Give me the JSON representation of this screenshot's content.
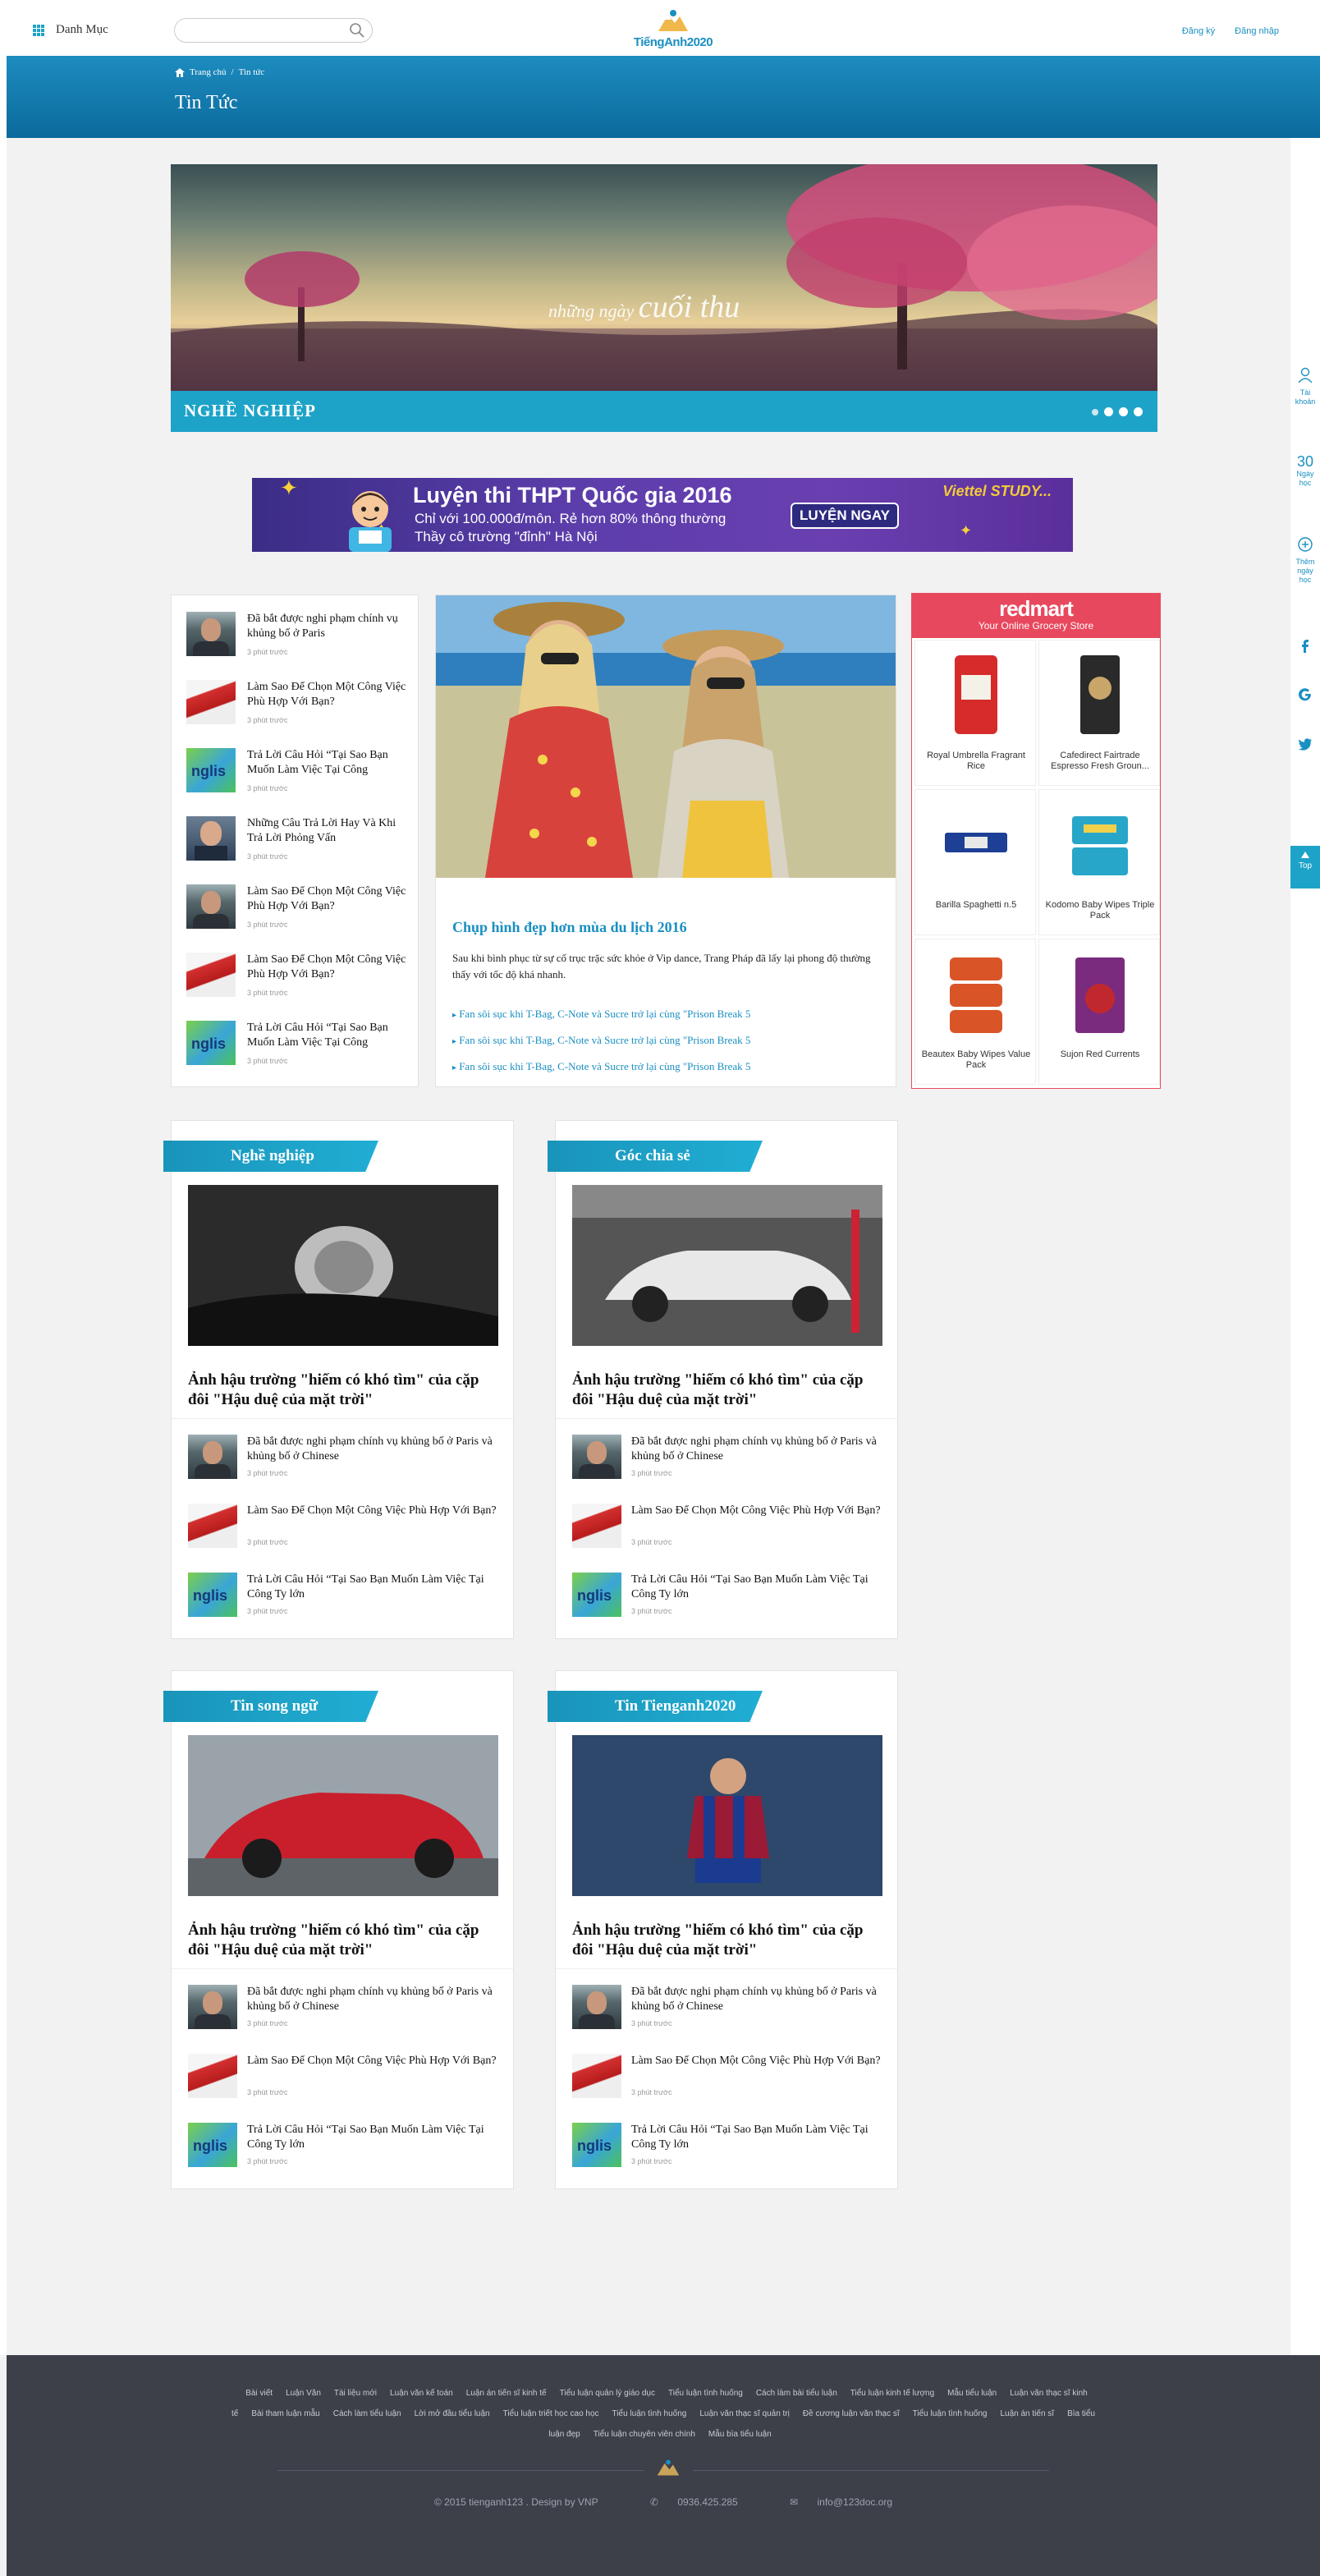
{
  "header": {
    "menu_label": "Danh Mục",
    "search_placeholder": "",
    "logo_text": "TiếngAnh2020",
    "register": "Đăng ký",
    "login": "Đăng nhập"
  },
  "breadcrumb": {
    "home": "Trang chủ",
    "separator": "/",
    "current": "Tin tức"
  },
  "page_title": "Tin Tức",
  "right_rail": {
    "account": "Tài khoản",
    "days_number": "30",
    "days_label": "Ngày học",
    "add_days": "Thêm ngày học",
    "top": "Top"
  },
  "slider": {
    "label": "NGHỀ NGHIỆP",
    "slide_text_small": "những ngày",
    "slide_text_big": "cuối thu",
    "dot_count": 4
  },
  "ad": {
    "title": "Luyện thi THPT Quốc gia 2016",
    "line1": "Chỉ với 100.000đ/môn. Rẻ hơn 80% thông thường",
    "line2": "Thầy cô trường \"đỉnh\" Hà Nội",
    "cta": "LUYỆN NGAY",
    "brand": "Viettel STUDY..."
  },
  "news_list": [
    {
      "title": "Đã bắt được nghi phạm chính vụ khủng bố ở Paris",
      "time": "3 phút trước",
      "thumb": "person"
    },
    {
      "title": "Làm Sao Để Chọn Một Công Việc Phù Hợp Với Bạn?",
      "time": "3 phút trước",
      "thumb": "card"
    },
    {
      "title": "Trả Lời Câu Hỏi “Tại Sao Bạn Muốn Làm Việc Tại Công",
      "time": "3 phút trước",
      "thumb": "eng"
    },
    {
      "title": "Những Câu Trả Lời Hay Và Khi Trả Lời Phỏng Vấn",
      "time": "3 phút trước",
      "thumb": "man2"
    },
    {
      "title": "Làm Sao Để Chọn Một Công Việc Phù Hợp Với Bạn?",
      "time": "3 phút trước",
      "thumb": "person"
    },
    {
      "title": "Làm Sao Để Chọn Một Công Việc Phù Hợp Với Bạn?",
      "time": "3 phút trước",
      "thumb": "card"
    },
    {
      "title": "Trả Lời Câu Hỏi “Tại Sao Bạn Muốn Làm Việc Tại Công",
      "time": "3 phút trước",
      "thumb": "eng"
    }
  ],
  "feature": {
    "title": "Chụp hình đẹp hơn mùa du lịch 2016",
    "desc": "Sau khi bình phục từ sự cố trục trặc sức khỏe ở Vip dance, Trang Pháp đã lấy lại phong độ thường thấy với tốc độ khá nhanh.",
    "links": [
      "Fan sôi sục khi T-Bag, C-Note và Sucre trở lại cùng \"Prison Break 5",
      "Fan sôi sục khi T-Bag, C-Note và Sucre trở lại cùng \"Prison Break 5",
      "Fan sôi sục khi T-Bag, C-Note và Sucre trở lại cùng \"Prison Break 5"
    ]
  },
  "redmart": {
    "brand": "redmart",
    "sub": "Your Online Grocery Store",
    "products": [
      "Royal Umbrella Fragrant Rice",
      "Cafedirect Fairtrade Espresso Fresh Groun...",
      "Barilla Spaghetti n.5",
      "Kodomo Baby Wipes Triple Pack",
      "Beautex Baby Wipes Value Pack",
      "Sujon Red Currents"
    ]
  },
  "categories": [
    {
      "name": "Nghề nghiệp",
      "headline": "Ảnh hậu trường \"hiếm có khó tìm\" của cặp đôi \"Hậu duệ của mặt trời\"",
      "image": "man-lying"
    },
    {
      "name": "Góc chia sẻ",
      "headline": "Ảnh hậu trường \"hiếm có khó tìm\" của cặp đôi \"Hậu duệ của mặt trời\"",
      "image": "white-car"
    },
    {
      "name": "Tin song ngữ",
      "headline": "Ảnh hậu trường \"hiếm có khó tìm\" của cặp đôi \"Hậu duệ của mặt trời\"",
      "image": "red-car"
    },
    {
      "name": "Tin Tienganh2020",
      "headline": "Ảnh hậu trường \"hiếm có khó tìm\" của cặp đôi \"Hậu duệ của mặt trời\"",
      "image": "footballer"
    }
  ],
  "cat_items": [
    {
      "title": "Đã bắt được nghi phạm chính vụ khủng bố ở Paris và khủng bố ở Chinese",
      "time": "3 phút trước",
      "thumb": "person"
    },
    {
      "title": "Làm Sao Để Chọn Một Công Việc Phù Hợp Với Bạn?",
      "time": "3 phút trước",
      "thumb": "card"
    },
    {
      "title": "Trả Lời Câu Hỏi “Tại Sao Bạn Muốn Làm Việc Tại Công Ty lớn",
      "time": "3 phút trước",
      "thumb": "eng"
    }
  ],
  "footer": {
    "links": [
      "Bài viết",
      "Luận Văn",
      "Tài liệu mới",
      "Luận văn kế toán",
      "Luận án tiến sĩ kinh tế",
      "Tiểu luận quản lý giáo dục",
      "Tiểu luận tình huống",
      "Cách làm bài tiểu luận",
      "Tiểu luận kinh tế lượng",
      "Mẫu tiểu luận",
      "Luận văn thạc sĩ kinh tế",
      "Bài tham luận mẫu",
      "Cách làm tiểu luận",
      "Lời mở đầu tiểu luận",
      "Tiểu luận triết học cao học",
      "Tiểu luận tình huống",
      "Luận văn thạc sĩ quản trị",
      "Đề cương luận văn thạc sĩ",
      "Tiểu luận tình huống",
      "Luận án tiến sĩ",
      "Bìa tiểu luận đẹp",
      "Tiểu luận chuyên viên chính",
      "Mẫu bìa tiểu luận"
    ],
    "copyright": "© 2015 tienganh123 . Design by VNP",
    "phone": "0936.425.285",
    "email": "info@123doc.org"
  },
  "colors": {
    "accent": "#1ea3c8",
    "header_band": "#0b6a9c",
    "footer_bg": "#3d4049",
    "redmart": "#e8485e"
  }
}
